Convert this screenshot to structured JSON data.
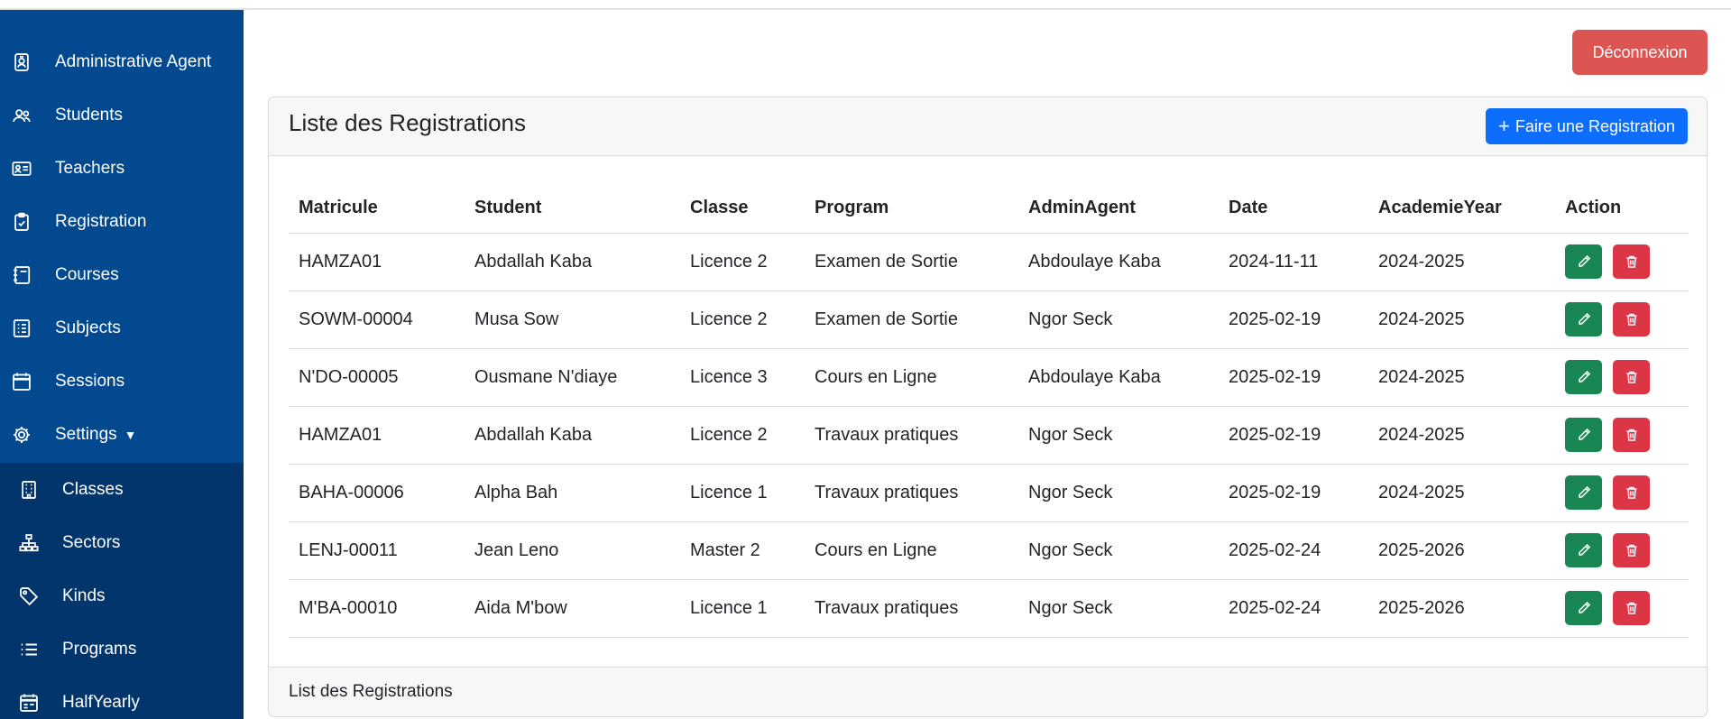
{
  "sidebar": {
    "items": [
      {
        "label": "Administrative Agent",
        "icon": "id-badge-icon"
      },
      {
        "label": "Students",
        "icon": "people-icon"
      },
      {
        "label": "Teachers",
        "icon": "person-vcard-icon"
      },
      {
        "label": "Registration",
        "icon": "clipboard-check-icon"
      },
      {
        "label": "Courses",
        "icon": "journal-icon"
      },
      {
        "label": "Subjects",
        "icon": "list-document-icon"
      },
      {
        "label": "Sessions",
        "icon": "calendar-icon"
      },
      {
        "label": "Settings",
        "icon": "gear-icon"
      }
    ],
    "settings_items": [
      {
        "label": "Classes",
        "icon": "building-icon"
      },
      {
        "label": "Sectors",
        "icon": "diagram-icon"
      },
      {
        "label": "Kinds",
        "icon": "tag-icon"
      },
      {
        "label": "Programs",
        "icon": "list-icon"
      },
      {
        "label": "HalfYearly",
        "icon": "calendar-week-icon"
      }
    ]
  },
  "header": {
    "logout_label": "Déconnexion"
  },
  "card": {
    "title": "Liste des Registrations",
    "add_label": "Faire une Registration",
    "footer": "List des Registrations"
  },
  "table": {
    "columns": [
      "Matricule",
      "Student",
      "Classe",
      "Program",
      "AdminAgent",
      "Date",
      "AcademieYear",
      "Action"
    ],
    "rows": [
      [
        "HAMZA01",
        "Abdallah Kaba",
        "Licence 2",
        "Examen de Sortie",
        "Abdoulaye Kaba",
        "2024-11-11",
        "2024-2025"
      ],
      [
        "SOWM-00004",
        "Musa Sow",
        "Licence 2",
        "Examen de Sortie",
        "Ngor Seck",
        "2025-02-19",
        "2024-2025"
      ],
      [
        "N'DO-00005",
        "Ousmane N'diaye",
        "Licence 3",
        "Cours en Ligne",
        "Abdoulaye Kaba",
        "2025-02-19",
        "2024-2025"
      ],
      [
        "HAMZA01",
        "Abdallah Kaba",
        "Licence 2",
        "Travaux pratiques",
        "Ngor Seck",
        "2025-02-19",
        "2024-2025"
      ],
      [
        "BAHA-00006",
        "Alpha Bah",
        "Licence 1",
        "Travaux pratiques",
        "Ngor Seck",
        "2025-02-19",
        "2024-2025"
      ],
      [
        "LENJ-00011",
        "Jean Leno",
        "Master 2",
        "Cours en Ligne",
        "Ngor Seck",
        "2025-02-24",
        "2025-2026"
      ],
      [
        "M'BA-00010",
        "Aida M'bow",
        "Licence 1",
        "Travaux pratiques",
        "Ngor Seck",
        "2025-02-24",
        "2025-2026"
      ]
    ]
  },
  "colors": {
    "sidebar": "#02498f",
    "sidebar_submenu": "#01356b",
    "logout": "#dc5552",
    "primary": "#0d6efd",
    "edit": "#198754",
    "delete": "#dc3545"
  }
}
